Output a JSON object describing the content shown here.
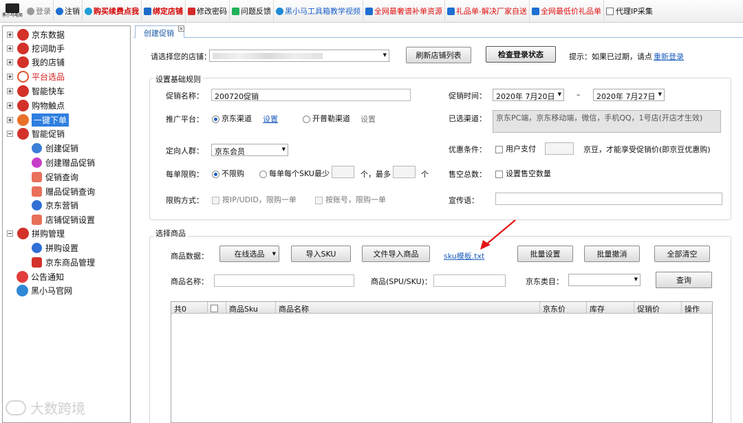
{
  "toolbar": {
    "logo_text": "黑小马电商",
    "login": "登录",
    "logout": "注销",
    "buy_points": "购买续费点我",
    "bind_store": "绑定店铺",
    "change_pwd": "修改密码",
    "feedback": "问题反馈",
    "tutorial": "黑小马工具箱教学视频",
    "resources": "全网最奢谱补单资源",
    "gift": "礼品单-解决厂家自送",
    "cheap_gift": "全网最低价礼品单",
    "proxy": "代理IP采集"
  },
  "sidebar": {
    "items": [
      {
        "label": "京东数据"
      },
      {
        "label": "挖词助手"
      },
      {
        "label": "我的店铺"
      },
      {
        "label": "平台选品"
      },
      {
        "label": "智能快车"
      },
      {
        "label": "购物触点"
      },
      {
        "label": "一键下单"
      },
      {
        "label": "智能促销"
      },
      {
        "label": "创建促销"
      },
      {
        "label": "创建赠品促销"
      },
      {
        "label": "促销查询"
      },
      {
        "label": "赠品促销查询"
      },
      {
        "label": "京东营销"
      },
      {
        "label": "店铺促销设置"
      },
      {
        "label": "拼购管理"
      },
      {
        "label": "拼购设置"
      },
      {
        "label": "京东商品管理"
      },
      {
        "label": "公告通知"
      },
      {
        "label": "黑小马官网"
      }
    ],
    "watermark": "大数跨境"
  },
  "tab": {
    "label": "创建促销"
  },
  "store": {
    "label": "请选择您的店铺：",
    "refresh": "刷新店铺列表",
    "check": "检查登录状态",
    "hint": "提示：如果已过期，请点",
    "relogin": "重新登录"
  },
  "basic": {
    "title": "设置基础规则",
    "name_label": "促销名称：",
    "name_value": "200720促销",
    "time_label": "促销时间：",
    "start": "2020年 7月20日",
    "dash": "–",
    "end": "2020年 7月27日",
    "platform_label": "推广平台：",
    "jd_channel": "京东渠道",
    "settings": "设置",
    "pupu": "开普勒渠道",
    "settings2": "设置",
    "selected_label": "已选渠道：",
    "selected_value": "京东PC端，京东移动端，微信，手机QQ，1号店(开店才生效)",
    "audience_label": "定向人群：",
    "audience_value": "京东会员",
    "discount_label": "优惠条件：",
    "user_pay": "用户支付",
    "beans_text": "京豆，才能享受促销价(即京豆优惠购)",
    "limit_label": "每单限购：",
    "no_limit": "不限购",
    "per_sku": "每单每个SKU最少",
    "unit1": "个，最多",
    "unit2": "个",
    "sellout_label": "售空总数：",
    "sellout_set": "设置售空数量",
    "method_label": "限购方式：",
    "by_ip": "按IP/UDID，限购一单",
    "by_account": "按账号，限购一单",
    "slogan_label": "宣传语："
  },
  "goods": {
    "title": "选择商品",
    "data_label": "商品数据：",
    "online": "在线选品",
    "import_sku": "导入SKU",
    "file_import": "文件导入商品",
    "template": "sku模板.txt",
    "batch_set": "批量设置",
    "batch_cancel": "批量撤消",
    "clear_all": "全部清空",
    "name_label": "商品名称：",
    "spu_label": "商品(SPU/SKU)：",
    "category_label": "京东类目：",
    "query": "查询"
  },
  "table": {
    "columns": [
      "共0",
      "",
      "商品Sku",
      "商品名称",
      "京东价",
      "库存",
      "促销价",
      "操作"
    ]
  }
}
